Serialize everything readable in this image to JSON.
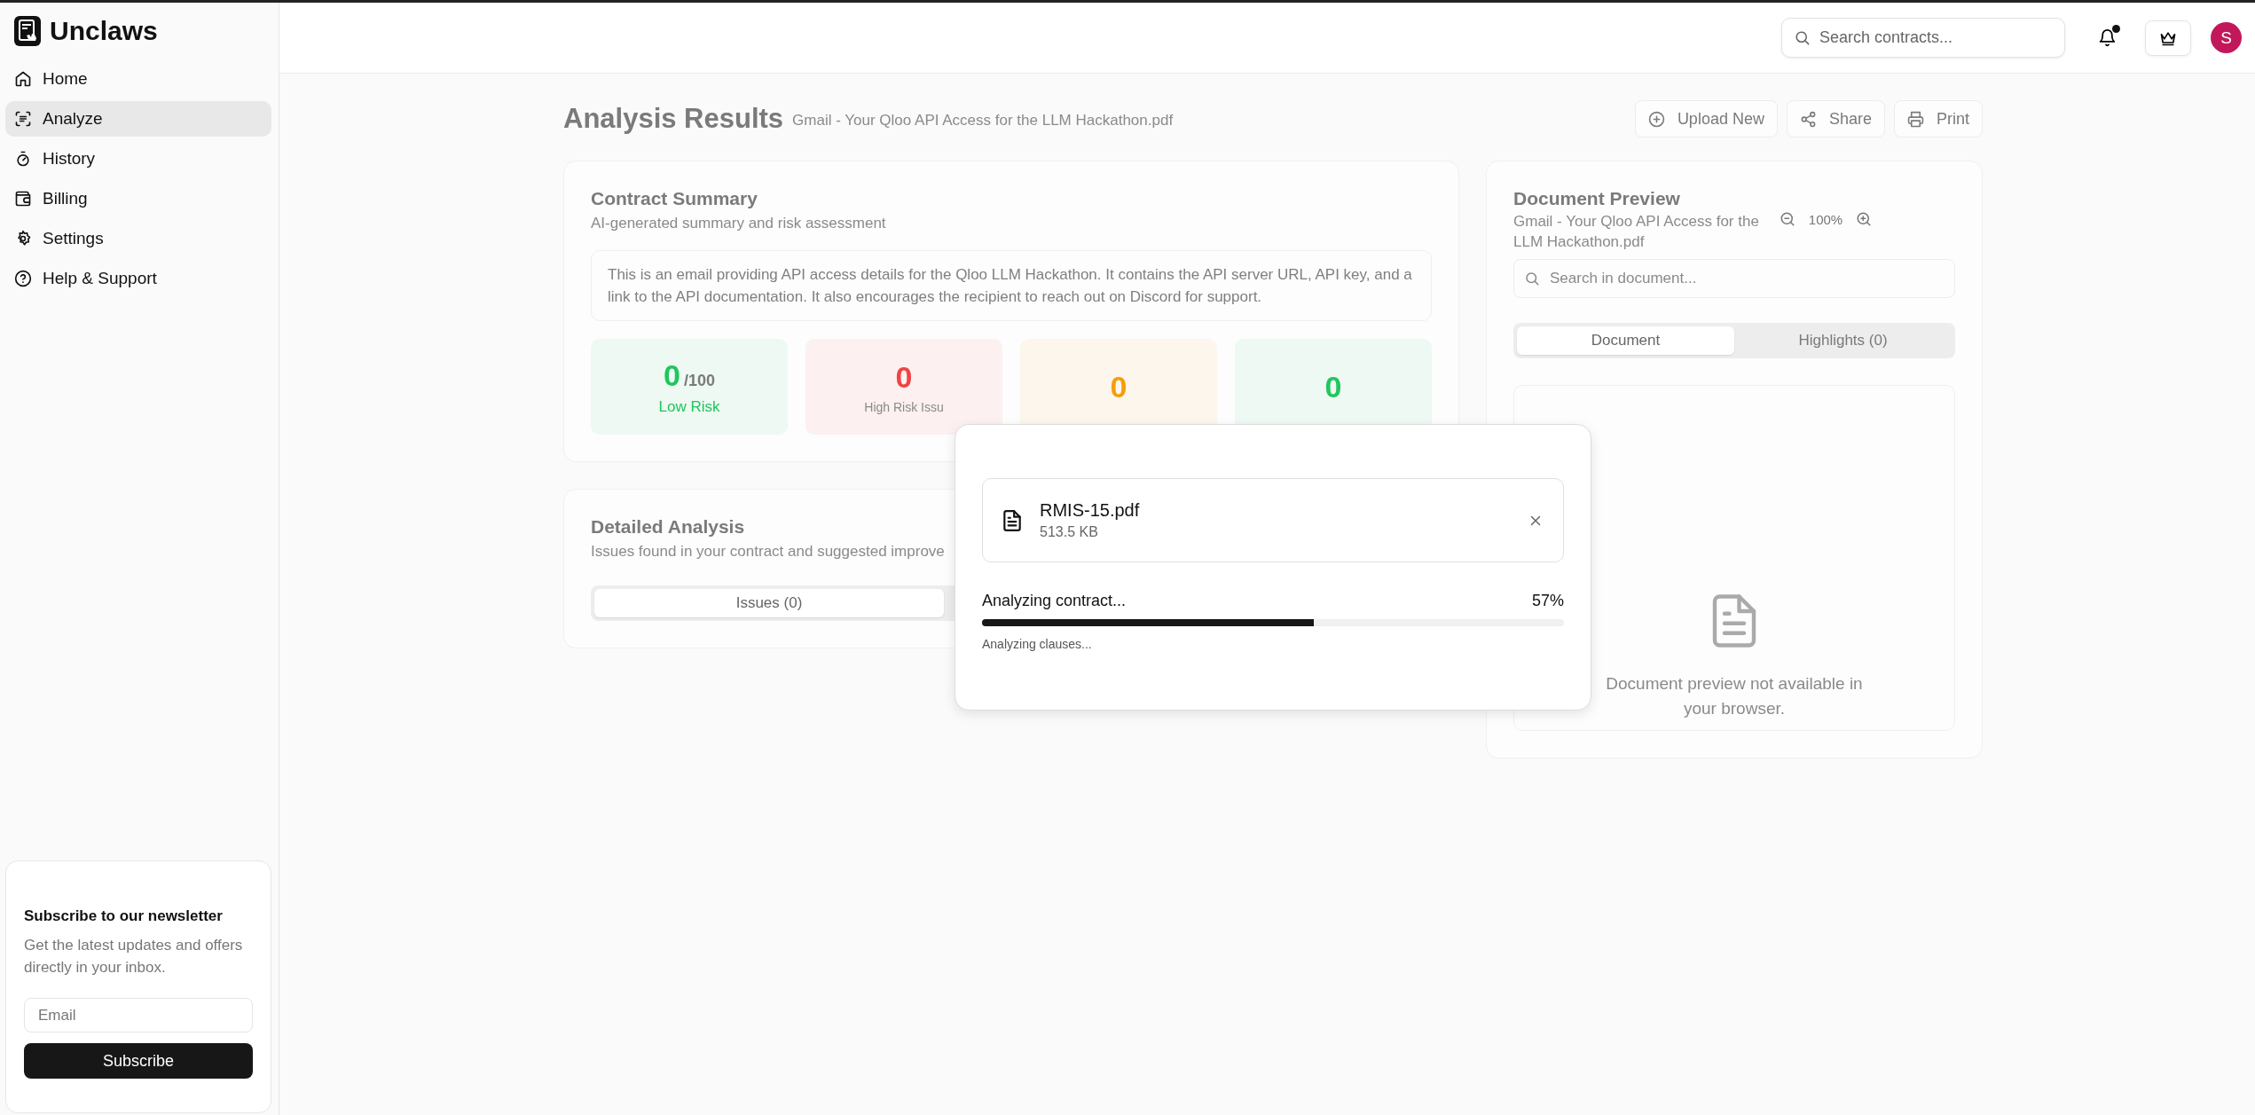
{
  "brand": {
    "name": "Unclaws"
  },
  "nav": [
    {
      "label": "Home",
      "selected": false
    },
    {
      "label": "Analyze",
      "selected": true
    },
    {
      "label": "History",
      "selected": false
    },
    {
      "label": "Billing",
      "selected": false
    },
    {
      "label": "Settings",
      "selected": false
    },
    {
      "label": "Help & Support",
      "selected": false
    }
  ],
  "newsletter": {
    "title": "Subscribe to our newsletter",
    "description": "Get the latest updates and offers directly in your inbox.",
    "email": {
      "placeholder": "Email"
    },
    "button": "Subscribe"
  },
  "header": {
    "search": {
      "placeholder": "Search contracts..."
    },
    "unread": true,
    "avatar": "S"
  },
  "page": {
    "title": "Analysis Results",
    "file_name": "Gmail - Your Qloo API Access for the LLM Hackathon.pdf",
    "actions": [
      "Upload New",
      "Share",
      "Print"
    ]
  },
  "summary": {
    "title": "Contract Summary",
    "subtitle": "AI-generated summary and risk assessment",
    "text": "This is an email providing API access details for the Qloo LLM Hackathon. It contains the API server URL, API key, and a link to the API documentation. It also encourages the recipient to reach out on Discord for support.",
    "stats": [
      {
        "value": "0",
        "suffix": "/100",
        "label": "Low Risk",
        "color": "#22c55e"
      },
      {
        "value": "0",
        "label": "High Risk Issu",
        "color": "#ef4444"
      },
      {
        "value": "0",
        "color": "#f59e0b"
      },
      {
        "value": "0",
        "color": "#22c55e"
      }
    ]
  },
  "analysis": {
    "title": "Detailed Analysis",
    "subtitle": "Issues found in your contract and suggested improve",
    "tabs": [
      {
        "label": "Issues (0)",
        "selected": true
      }
    ]
  },
  "preview": {
    "title": "Document Preview",
    "file_name": "Gmail - Your Qloo API Access for the LLM Hackathon.pdf",
    "zoom": "100%",
    "search": {
      "placeholder": "Search in document..."
    },
    "tabs": [
      {
        "label": "Document",
        "selected": true
      },
      {
        "label": "Highlights (0)",
        "selected": false
      }
    ],
    "empty_message": "Document preview not available in your browser."
  },
  "upload": {
    "file_name": "RMIS-15.pdf",
    "file_size": "513.5 KB",
    "status": "Analyzing contract...",
    "percent": "57%",
    "level": 0.57,
    "step": "Analyzing clauses..."
  }
}
